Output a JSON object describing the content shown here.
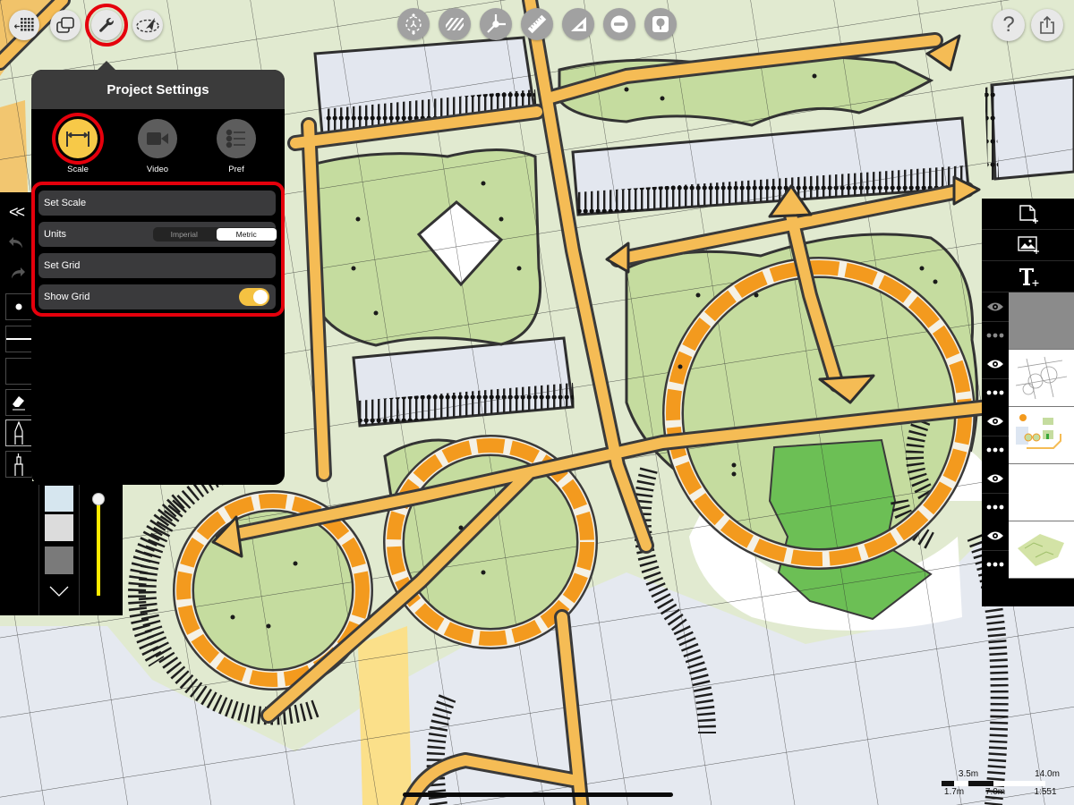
{
  "top_toolbar": {
    "left": [
      {
        "id": "gallery",
        "icon": "gallery-grid-icon"
      },
      {
        "id": "duplicate",
        "icon": "duplicate-pages-icon"
      },
      {
        "id": "project-settings",
        "icon": "wrench-icon",
        "active": true,
        "highlighted": true
      },
      {
        "id": "select",
        "icon": "lasso-select-icon"
      }
    ],
    "center": [
      {
        "id": "transform",
        "icon": "transform-icon"
      },
      {
        "id": "hatch",
        "icon": "hatch-icon"
      },
      {
        "id": "perspective",
        "icon": "perspective-axes-icon"
      },
      {
        "id": "ruler",
        "icon": "ruler-icon"
      },
      {
        "id": "set-square",
        "icon": "set-square-icon"
      },
      {
        "id": "shape",
        "icon": "circle-minus-icon"
      },
      {
        "id": "stamp",
        "icon": "tree-stamp-icon"
      }
    ],
    "right": [
      {
        "id": "help",
        "icon": "help-icon",
        "label": "?"
      },
      {
        "id": "share",
        "icon": "share-icon"
      }
    ]
  },
  "project_settings": {
    "title": "Project Settings",
    "tabs": [
      {
        "label": "Scale",
        "icon": "scale-icon",
        "selected": true
      },
      {
        "label": "Video",
        "icon": "video-camera-icon",
        "selected": false
      },
      {
        "label": "Pref",
        "icon": "list-icon",
        "selected": false
      }
    ],
    "set_scale_label": "Set Scale",
    "units": {
      "label": "Units",
      "options": [
        "Imperial",
        "Metric"
      ],
      "selected": "Metric"
    },
    "set_grid_label": "Set Grid",
    "show_grid": {
      "label": "Show Grid",
      "on": true
    }
  },
  "left_toolbar": {
    "collapse_label": "<<",
    "actions": [
      {
        "id": "undo",
        "icon": "undo-icon"
      },
      {
        "id": "redo",
        "icon": "redo-icon"
      }
    ],
    "tools": [
      {
        "id": "dot-size",
        "icon": "dot-icon"
      },
      {
        "id": "line-weight",
        "icon": "line-weight-icon"
      },
      {
        "id": "empty",
        "icon": "empty-slot"
      },
      {
        "id": "eraser",
        "icon": "eraser-icon"
      },
      {
        "id": "pen",
        "icon": "pen-icon",
        "selected": true
      },
      {
        "id": "fine-liner",
        "icon": "fine-liner-icon"
      },
      {
        "id": "pencil",
        "icon": "pencil-icon"
      },
      {
        "id": "marker",
        "icon": "marker-icon"
      },
      {
        "id": "brush",
        "icon": "brush-icon"
      },
      {
        "id": "highlighter",
        "icon": "highlighter-icon"
      }
    ]
  },
  "palette": {
    "swatches": [
      "#d6e6ef",
      "#dcdcdc",
      "#7a7a7a"
    ],
    "more_icon": "chevron-down-icon",
    "brush_slider_color": "#ffea00",
    "brush_size_fraction": 1.0
  },
  "layers_panel": {
    "actions": [
      {
        "id": "new-layer",
        "icon": "new-page-icon"
      },
      {
        "id": "import-image",
        "icon": "add-image-icon"
      },
      {
        "id": "add-text",
        "icon": "add-text-icon"
      }
    ],
    "layers": [
      {
        "visible": true,
        "thumbnail": "gray-fill"
      },
      {
        "visible": true,
        "thumbnail": "pencil-sketch-plan"
      },
      {
        "visible": true,
        "thumbnail": "color-site-plan"
      },
      {
        "visible": true,
        "thumbnail": "blank"
      },
      {
        "visible": true,
        "thumbnail": "green-aerial-plan"
      }
    ]
  },
  "scale_bar": {
    "upper_labels": [
      "3.5m",
      "14.0m"
    ],
    "lower_labels": [
      "1.7m",
      "7.0m"
    ],
    "ratio": "1:551"
  },
  "theme": {
    "highlight_ring": "#e5000c",
    "toggle_on": "#f5c242",
    "scale_tab_fill": "#f7c948",
    "road_orange": "#f5bc55",
    "path_orange": "#f39a1e",
    "lawn_green": "#c5dc9f",
    "plaza_green": "#6cbf55"
  }
}
